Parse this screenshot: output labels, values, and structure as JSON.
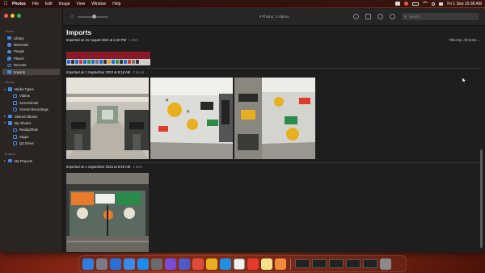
{
  "menubar": {
    "app_name": "Photos",
    "menus": [
      "File",
      "Edit",
      "Image",
      "View",
      "Window",
      "Help"
    ],
    "clock": "Fri 1 Sep  10:38 AM"
  },
  "sidebar": {
    "sections": [
      {
        "title": "Photos",
        "items": [
          {
            "label": "Library",
            "icon": "photo-library-icon",
            "color": "#3d8bf0"
          },
          {
            "label": "Memories",
            "icon": "memories-icon",
            "color": "#3d8bf0"
          },
          {
            "label": "People",
            "icon": "people-icon",
            "color": "#3d8bf0"
          },
          {
            "label": "Places",
            "icon": "places-icon",
            "color": "#3d8bf0"
          },
          {
            "label": "Recents",
            "icon": "recents-icon",
            "color": "#3d8bf0"
          },
          {
            "label": "Imports",
            "icon": "imports-icon",
            "color": "#3d8bf0"
          }
        ]
      },
      {
        "title": "Albums",
        "items": [
          {
            "label": "Media Types",
            "icon": "folder-icon",
            "color": "#3d8bf0"
          },
          {
            "label": "Videos",
            "icon": "videos-icon",
            "color": "#3d8bf0"
          },
          {
            "label": "Screenshots",
            "icon": "screenshots-icon",
            "color": "#3d8bf0"
          },
          {
            "label": "Screen Recordings",
            "icon": "screen-recordings-icon",
            "color": "#3d8bf0"
          },
          {
            "label": "Shared Albums",
            "icon": "shared-albums-icon",
            "color": "#3d8bf0"
          },
          {
            "label": "My Albums",
            "icon": "folder-icon",
            "color": "#3d8bf0"
          },
          {
            "label": "Ready2Ride",
            "icon": "album-icon",
            "color": "#3d8bf0"
          },
          {
            "label": "Skype",
            "icon": "album-icon",
            "color": "#3d8bf0"
          },
          {
            "label": "Q4 Driver",
            "icon": "album-icon",
            "color": "#3d8bf0"
          }
        ]
      },
      {
        "title": "Projects",
        "items": [
          {
            "label": "My Projects",
            "icon": "folder-icon",
            "color": "#3d8bf0"
          }
        ]
      }
    ]
  },
  "toolbar": {
    "counts": "5 Photos, 3 Videos",
    "search_placeholder": "Search"
  },
  "main": {
    "title": "Imports",
    "filter": "Filter By: All Items ⌄",
    "groups": [
      {
        "heading": "Imported on 31 August 2023 at 2:40 PM",
        "count": "1 Item"
      },
      {
        "heading": "Imported on 1 September 2023 at 9:18 AM",
        "count": "3 Items"
      },
      {
        "heading": "Imported on 1 September 2023 at 9:29 AM",
        "count": "1 Item"
      }
    ]
  },
  "dock": {
    "apps": [
      {
        "name": "finder-icon",
        "color": "#2f7ee0"
      },
      {
        "name": "launchpad-icon",
        "color": "#7a7a8a"
      },
      {
        "name": "xcode-icon",
        "color": "#2a6fd8"
      },
      {
        "name": "maps-icon",
        "color": "#3a8ae8"
      },
      {
        "name": "app-store-icon",
        "color": "#1a8cf0"
      },
      {
        "name": "system-settings-icon",
        "color": "#6a6a6a"
      },
      {
        "name": "visual-studio-icon",
        "color": "#7a4ad8"
      },
      {
        "name": "teams-icon",
        "color": "#5059c9"
      },
      {
        "name": "gmail-icon",
        "color": "#e04a3a"
      },
      {
        "name": "chrome-icon",
        "color": "#e8b020"
      },
      {
        "name": "skype-icon",
        "color": "#1f8fe0"
      },
      {
        "name": "facetime-icon",
        "color": "#f0f0f0"
      },
      {
        "name": "anydesk-icon",
        "color": "#e83a2a"
      },
      {
        "name": "notes-icon",
        "color": "#f4e08a"
      },
      {
        "name": "photos-icon",
        "color": "#f08a3a"
      }
    ]
  }
}
